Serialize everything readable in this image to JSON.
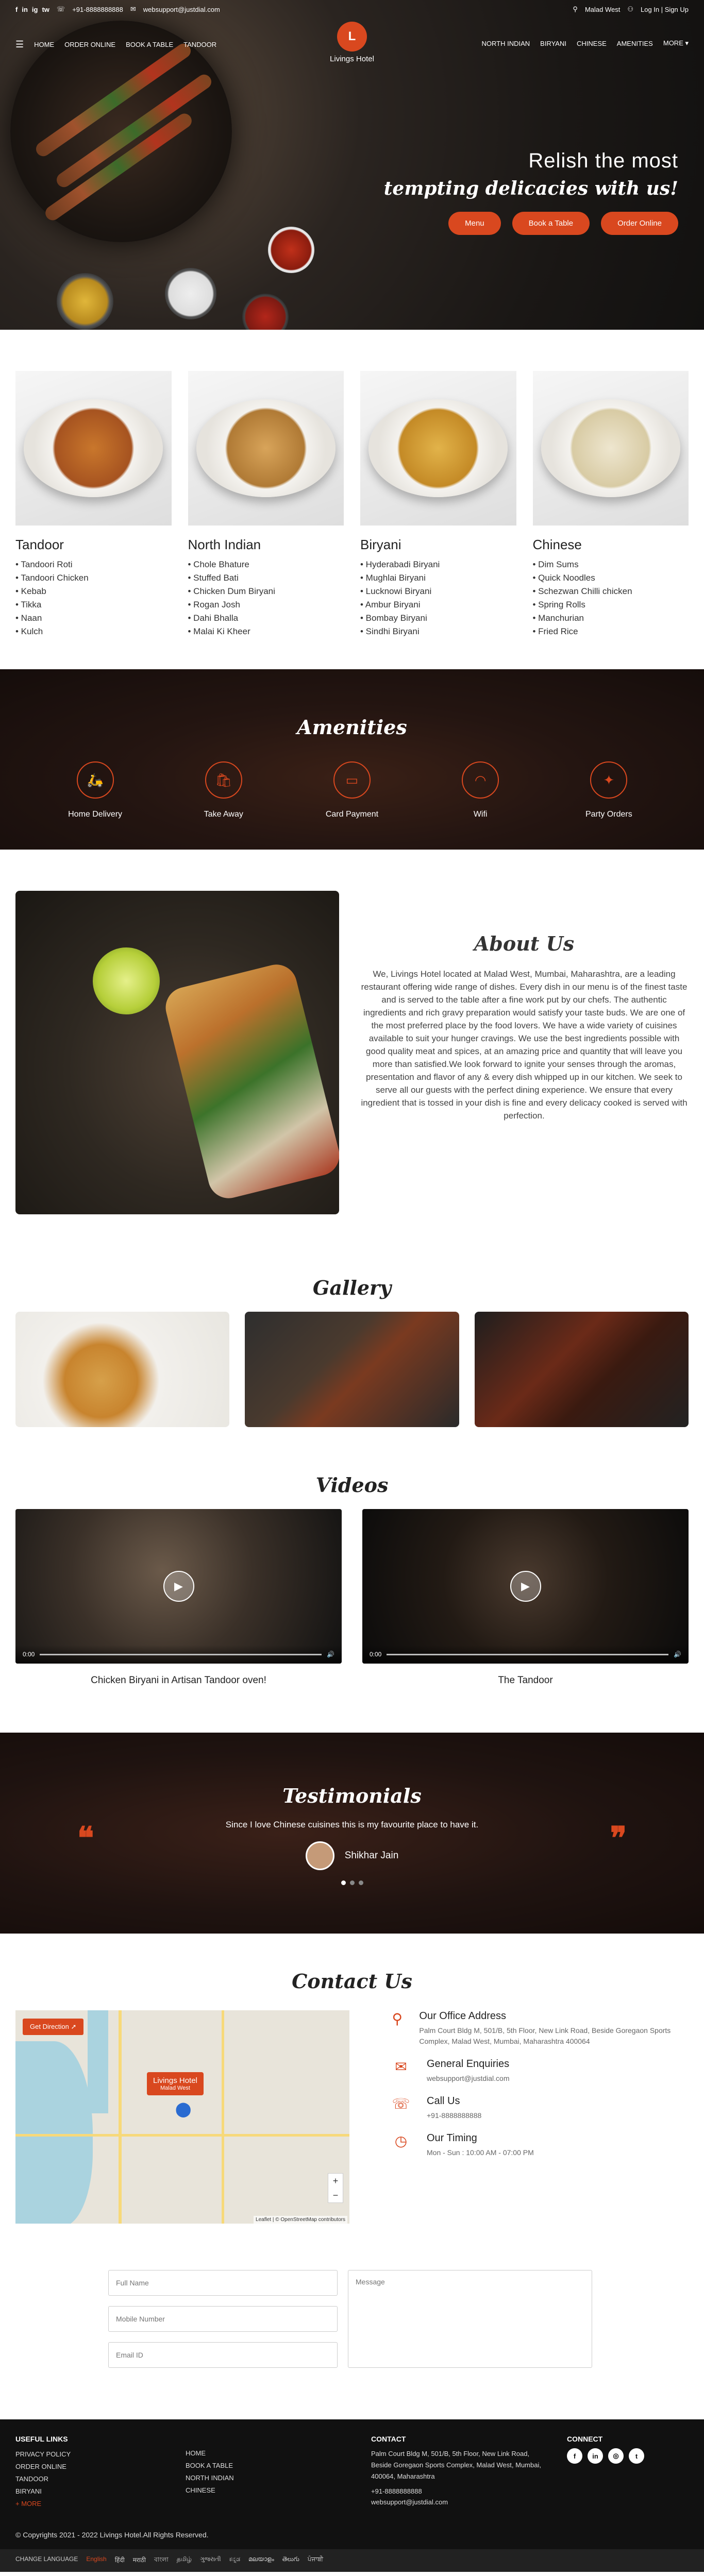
{
  "topbar": {
    "phone": "+91-8888888888",
    "email": "websupport@justdial.com",
    "location": "Malad West",
    "login": "Log In | Sign Up",
    "social": [
      "f",
      "in",
      "ig",
      "tw"
    ]
  },
  "nav": {
    "left": [
      "HOME",
      "ORDER ONLINE",
      "BOOK A TABLE",
      "TANDOOR"
    ],
    "right": [
      "NORTH INDIAN",
      "BIRYANI",
      "CHINESE",
      "AMENITIES",
      "MORE ▾"
    ]
  },
  "logo": {
    "badge": "L",
    "name": "Livings Hotel"
  },
  "hero": {
    "line1": "Relish the most",
    "line2": "tempting delicacies with us!",
    "buttons": [
      "Menu",
      "Book a Table",
      "Order Online"
    ]
  },
  "categories": [
    {
      "title": "Tandoor",
      "items": [
        "• Tandoori Roti",
        "• Tandoori Chicken",
        "• Kebab",
        "• Tikka",
        "• Naan",
        "• Kulch"
      ]
    },
    {
      "title": "North Indian",
      "items": [
        "• Chole Bhature",
        "• Stuffed Bati",
        "• Chicken Dum Biryani",
        "• Rogan Josh",
        "• Dahi Bhalla",
        "• Malai Ki Kheer"
      ]
    },
    {
      "title": "Biryani",
      "items": [
        "• Hyderabadi Biryani",
        "• Mughlai Biryani",
        "• Lucknowi Biryani",
        "• Ambur Biryani",
        "• Bombay Biryani",
        "• Sindhi Biryani"
      ]
    },
    {
      "title": "Chinese",
      "items": [
        "• Dim Sums",
        "• Quick Noodles",
        "• Schezwan Chilli chicken",
        "• Spring Rolls",
        "• Manchurian",
        "• Fried Rice"
      ]
    }
  ],
  "amenities": {
    "title": "Amenities",
    "items": [
      "Home Delivery",
      "Take Away",
      "Card Payment",
      "Wifi",
      "Party Orders"
    ]
  },
  "about": {
    "title": "About Us",
    "text": "We, Livings Hotel located at Malad West, Mumbai, Maharashtra, are a leading restaurant offering wide range of dishes. Every dish in our menu is of the finest taste and is served to the table after a fine work put by our chefs. The authentic ingredients and rich gravy preparation would satisfy your taste buds. We are one of the most preferred place by the food lovers. We have a wide variety of cuisines available to suit your hunger cravings. We use the best ingredients possible with good quality meat and spices, at an amazing price and quantity that will leave you more than satisfied.We look forward to ignite your senses through the aromas, presentation and flavor of any & every dish whipped up in our kitchen. We seek to serve all our guests with the perfect dining experience. We ensure that every ingredient that is tossed in your dish is fine and every delicacy cooked is served with perfection."
  },
  "gallery": {
    "title": "Gallery"
  },
  "videos": {
    "title": "Videos",
    "items": [
      {
        "caption": "Chicken Biryani in Artisan Tandoor oven!",
        "time": "0:00"
      },
      {
        "caption": "The Tandoor",
        "time": "0:00"
      }
    ]
  },
  "testimonials": {
    "title": "Testimonials",
    "quote": "Since I love Chinese cuisines this is my favourite place to have it.",
    "author": "Shikhar Jain"
  },
  "contact": {
    "title": "Contact Us",
    "direction": "Get Direction ➚",
    "pin_name": "Livings Hotel",
    "pin_sub": "Malad West",
    "map_attr": "Leaflet | © OpenStreetMap contributors",
    "office_h": "Our Office Address",
    "office": "Palm Court Bldg M, 501/B, 5th Floor, New Link Road, Beside Goregaon Sports Complex, Malad West, Mumbai, Maharashtra 400064",
    "enq_h": "General Enquiries",
    "enq": "websupport@justdial.com",
    "call_h": "Call Us",
    "call": "+91-8888888888",
    "time_h": "Our Timing",
    "time": "Mon - Sun : 10:00 AM - 07:00 PM"
  },
  "form": {
    "name": "Full Name",
    "mobile": "Mobile Number",
    "email": "Email ID",
    "message": "Message"
  },
  "footer": {
    "useful_h": "USEFUL LINKS",
    "useful": [
      "PRIVACY POLICY",
      "ORDER ONLINE",
      "TANDOOR",
      "BIRYANI",
      "+ MORE"
    ],
    "links2": [
      "HOME",
      "BOOK A TABLE",
      "NORTH INDIAN",
      "CHINESE"
    ],
    "contact_h": "CONTACT",
    "address": "Palm Court Bldg M, 501/B, 5th Floor, New Link Road, Beside Goregaon Sports Complex, Malad West, Mumbai, 400064, Maharashtra",
    "phone": "+91-8888888888",
    "email": "websupport@justdial.com",
    "connect_h": "CONNECT",
    "copy": "© Copyrights 2021 - 2022 Livings Hotel.All Rights Reserved."
  },
  "langbar": {
    "label": "CHANGE LANGUAGE",
    "langs": [
      "English",
      "हिंदी",
      "मराठी",
      "বাংলা",
      "தமிழ்",
      "ગુજરાતી",
      "ಕನ್ನಡ",
      "മലയാളം",
      "తెలుగు",
      "ਪੰਜਾਬੀ"
    ]
  },
  "colors": {
    "accent": "#d9481f",
    "dark": "#111111"
  }
}
